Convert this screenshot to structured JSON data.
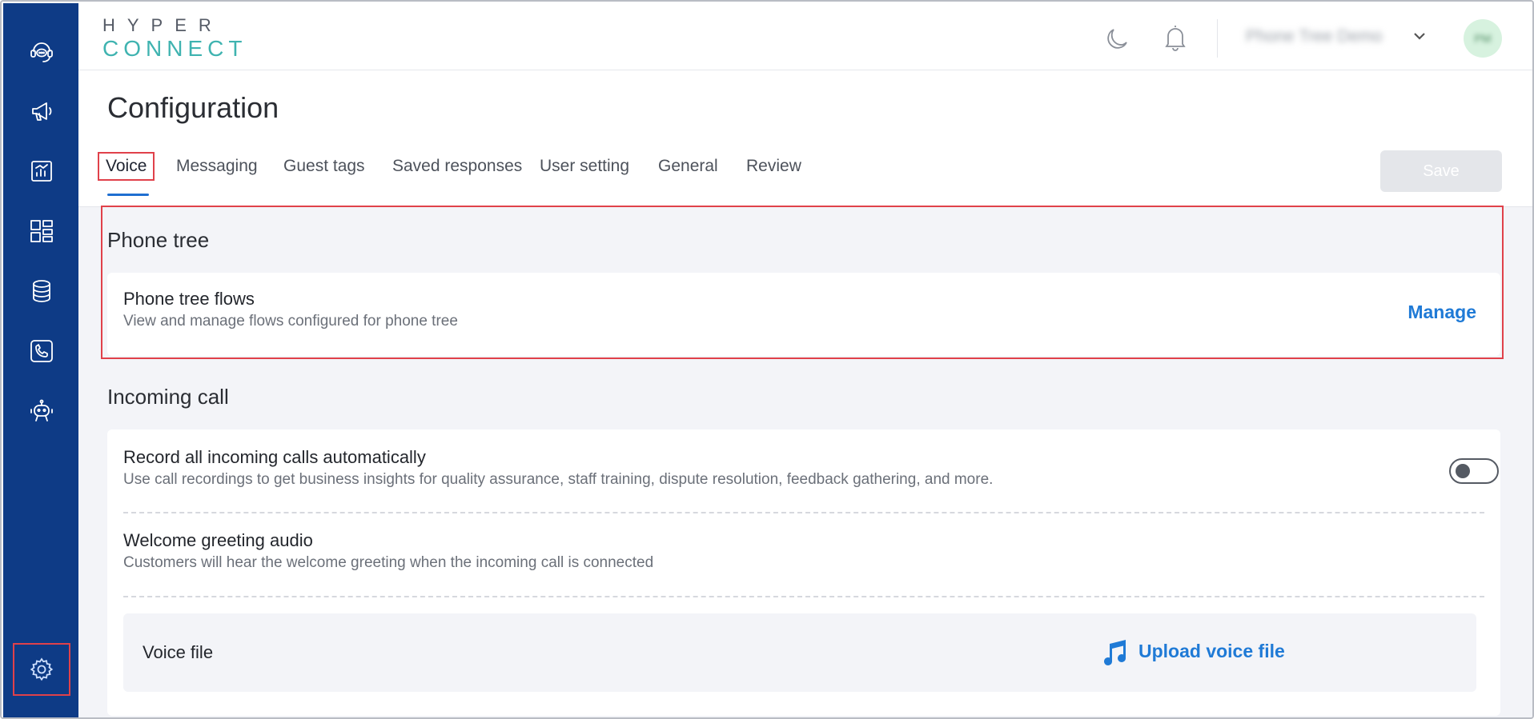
{
  "sidebar": {
    "items": [
      {
        "icon": "chat-headset-icon"
      },
      {
        "icon": "megaphone-icon"
      },
      {
        "icon": "report-chart-icon"
      },
      {
        "icon": "dashboard-grid-icon"
      },
      {
        "icon": "database-icon"
      },
      {
        "icon": "phone-icon"
      },
      {
        "icon": "bot-icon"
      }
    ],
    "settings_icon": "gear-icon"
  },
  "header": {
    "logo_top": "HYPER",
    "logo_bottom": "CONNECT",
    "account_name": "Phone Tree Demo",
    "avatar_initials": "PM"
  },
  "page": {
    "title": "Configuration",
    "tabs": [
      {
        "label": "Voice",
        "active": true
      },
      {
        "label": "Messaging"
      },
      {
        "label": "Guest tags"
      },
      {
        "label": "Saved responses"
      },
      {
        "label": "User setting"
      },
      {
        "label": "General"
      },
      {
        "label": "Review"
      }
    ],
    "save_label": "Save"
  },
  "phone_tree": {
    "section_title": "Phone tree",
    "flows_title": "Phone tree flows",
    "flows_desc": "View and manage flows configured for phone tree",
    "manage_label": "Manage"
  },
  "incoming_call": {
    "section_title": "Incoming call",
    "record_title": "Record all incoming calls automatically",
    "record_desc": "Use call recordings to get business insights for quality assurance, staff training, dispute resolution, feedback gathering, and more.",
    "record_enabled": false,
    "welcome_title": "Welcome greeting audio",
    "welcome_desc": "Customers will hear the welcome greeting when the incoming call is connected",
    "voice_file_label": "Voice file",
    "upload_label": "Upload voice file"
  },
  "colors": {
    "sidebar_bg": "#0e3b86",
    "accent": "#1f7ad6",
    "highlight": "#e0414a"
  }
}
